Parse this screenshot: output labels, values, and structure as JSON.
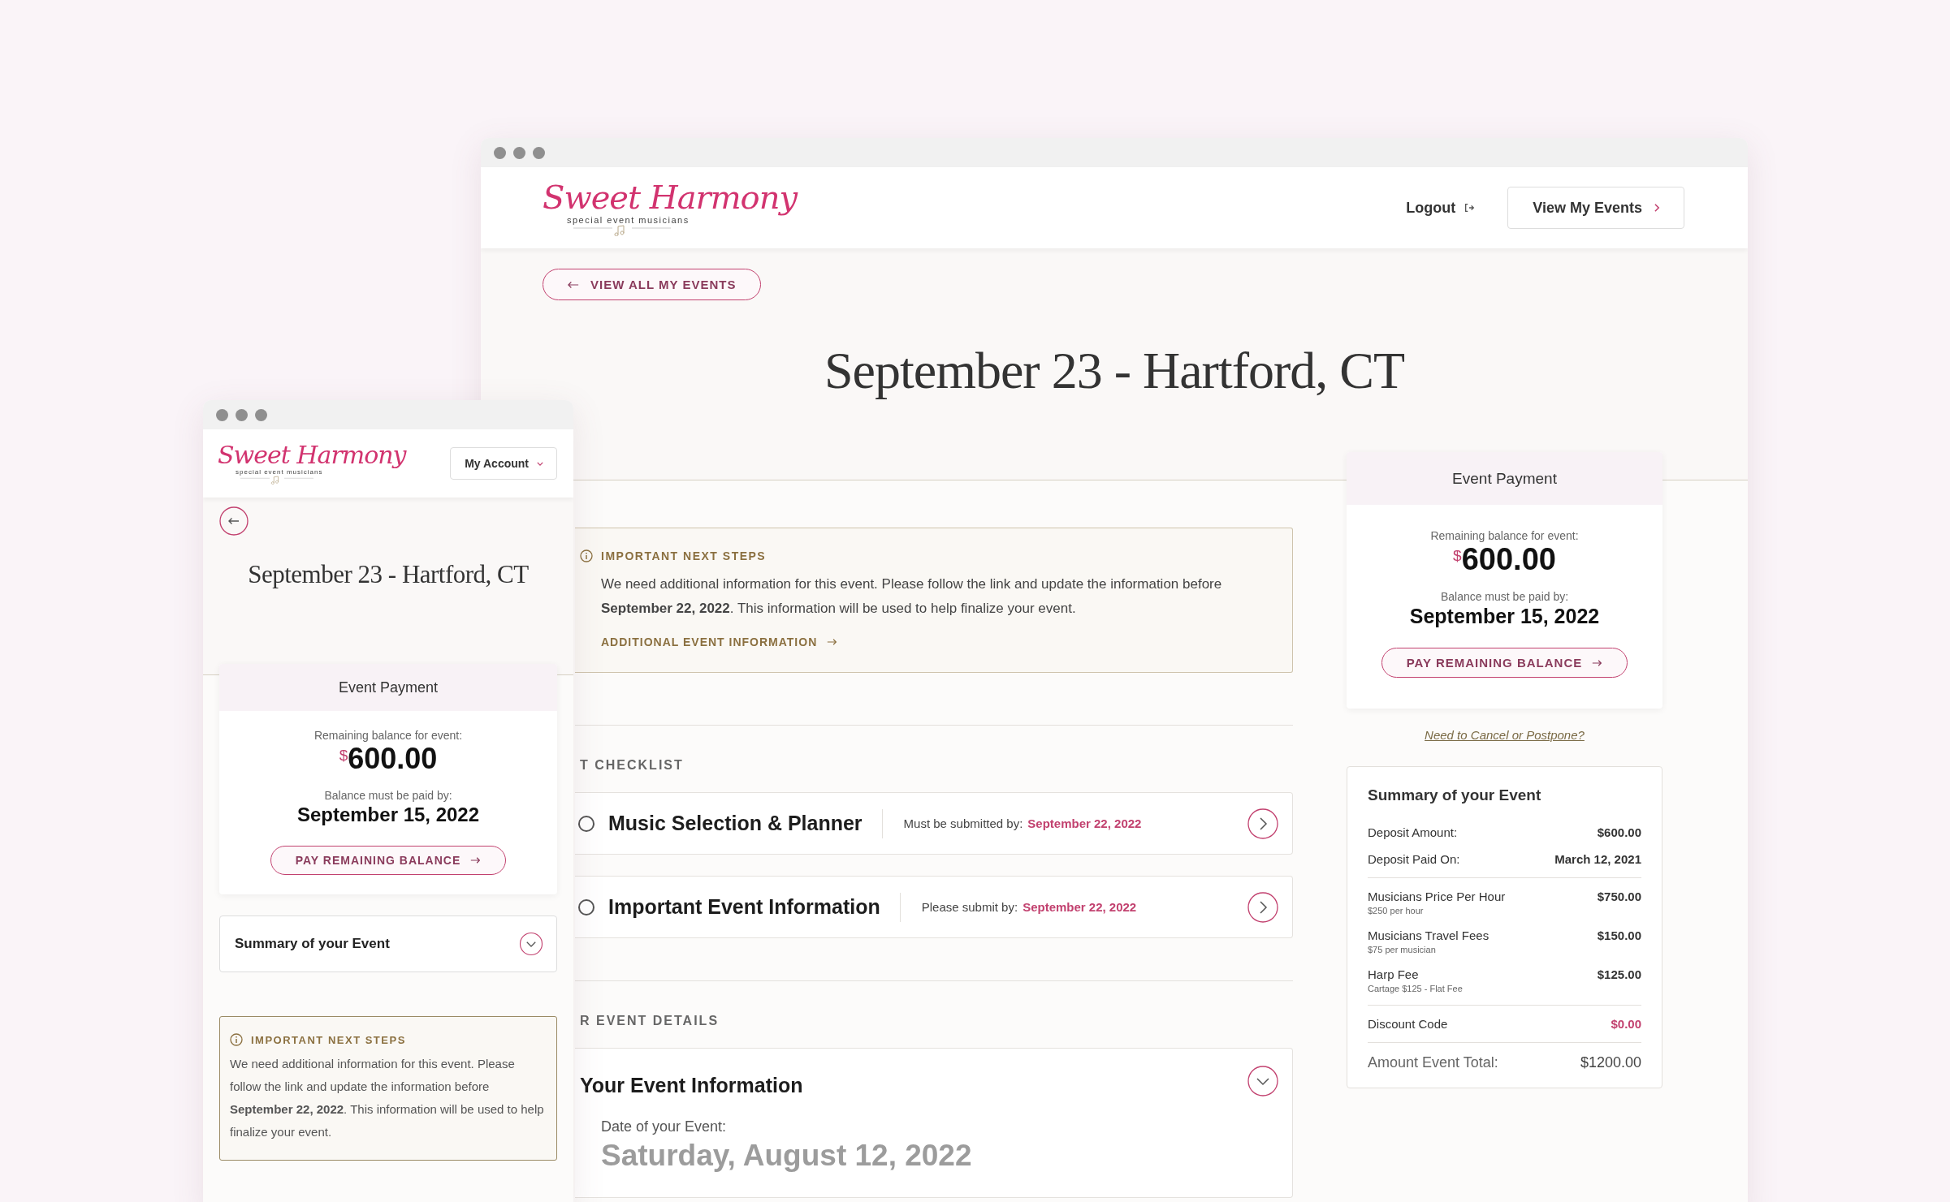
{
  "desktop": {
    "nav": {
      "logo_name": "Sweet Harmony",
      "logo_tagline": "special event musicians",
      "logout": "Logout",
      "view_events": "View My Events"
    },
    "back_button": "VIEW ALL MY EVENTS",
    "title": "September 23 - Hartford, CT",
    "next_steps": {
      "heading": "IMPORTANT NEXT STEPS",
      "text": "We need additional information for this event. Please follow the link and update the information before **September 22, 2022**. This information will be used to help finalize your event.",
      "link": "ADDITIONAL EVENT INFORMATION"
    },
    "checklist": {
      "heading": "T CHECKLIST",
      "items": [
        {
          "title": "Music Selection & Planner",
          "due_label": "Must be submitted by:",
          "due_date": "September 22, 2022",
          "completed": false
        },
        {
          "title": "Important Event Information",
          "due_label": "Please submit by:",
          "due_date": "September 22, 2022",
          "completed": false
        }
      ]
    },
    "details": {
      "heading": "R EVENT DETAILS",
      "card_title": "Your Event Information",
      "date_label": "Date of your Event:",
      "date": "Saturday, August 12, 2022"
    },
    "payment": {
      "title": "Event Payment",
      "remaining_label": "Remaining balance for event:",
      "currency": "$",
      "amount": "600.00",
      "due_label": "Balance must be paid by:",
      "due_date": "September 15, 2022",
      "button": "PAY REMAINING BALANCE"
    },
    "cancel_link": "Need to Cancel or Postpone?",
    "summary": {
      "title": "Summary of your Event",
      "sections": [
        [
          {
            "kind": "plain",
            "label": "Deposit Amount:",
            "value": "$600.00"
          },
          {
            "kind": "plain",
            "label": "Deposit Paid On:",
            "value": "March 12, 2021"
          }
        ],
        [
          {
            "kind": "plain",
            "label": "Musicians Price Per Hour",
            "note": "$250 per hour",
            "value": "$750.00"
          },
          {
            "kind": "plain",
            "label": "Musicians Travel Fees",
            "note": "$75 per musician",
            "value": "$150.00"
          },
          {
            "kind": "plain",
            "label": "Harp Fee",
            "note": "Cartage $125 - Flat Fee",
            "value": "$125.00"
          }
        ],
        [
          {
            "kind": "discount",
            "label": "Discount Code",
            "value": "$0.00"
          }
        ],
        [
          {
            "kind": "total",
            "label": "Amount Event Total:",
            "value": "$1200.00"
          }
        ]
      ]
    }
  },
  "mobile": {
    "nav": {
      "logo_name": "Sweet Harmony",
      "logo_tagline": "special event musicians",
      "account_menu": "My Account"
    },
    "title": "September 23 - Hartford, CT",
    "payment": {
      "title": "Event Payment",
      "remaining_label": "Remaining balance for event:",
      "currency": "$",
      "amount": "600.00",
      "due_label": "Balance must be paid by:",
      "due_date": "September 15, 2022",
      "button": "PAY REMAINING BALANCE"
    },
    "summary": {
      "title": "Summary of your Event",
      "expanded": false
    },
    "next_steps": {
      "heading": "IMPORTANT NEXT STEPS",
      "text": "We need additional information for this event. Please follow the link and update the information before **September 22, 2022**. This information will be used to help finalize your event."
    }
  }
}
